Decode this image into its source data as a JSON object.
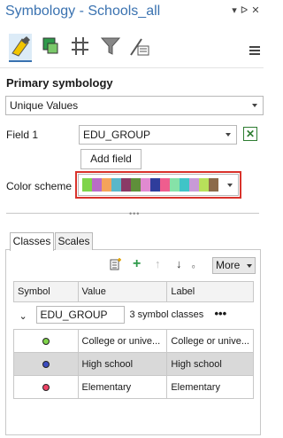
{
  "window": {
    "title": "Symbology - Schools_all"
  },
  "tools": [
    {
      "name": "primary-symbology-icon"
    },
    {
      "name": "vary-symbology-icon"
    },
    {
      "name": "symbol-layer-icon"
    },
    {
      "name": "filter-icon"
    },
    {
      "name": "advanced-options-icon"
    }
  ],
  "primary": {
    "section_title": "Primary symbology",
    "method": "Unique Values",
    "field1_label": "Field 1",
    "field1_value": "EDU_GROUP",
    "add_field_label": "Add field",
    "color_scheme_label": "Color scheme",
    "color_scheme_colors": [
      "#7fd44a",
      "#b96cc7",
      "#f5a35a",
      "#5ab7c9",
      "#8a3a66",
      "#5f8f3a",
      "#e08ad0",
      "#2f3d9c",
      "#ef5d8e",
      "#86e2a8",
      "#40c4c7",
      "#c89ad6",
      "#b8e05a",
      "#8c6a4a"
    ],
    "accent": "#d9322b"
  },
  "tabs": [
    {
      "label": "Classes"
    },
    {
      "label": "Scales"
    }
  ],
  "toolbar": {
    "more_label": "More"
  },
  "table": {
    "headers": [
      "Symbol",
      "Value",
      "Label"
    ],
    "group_field": "EDU_GROUP",
    "group_summary": "3 symbol classes",
    "rows": [
      {
        "value": "College or unive...",
        "label": "College or unive...",
        "color": "#7fd44a"
      },
      {
        "value": "High school",
        "label": "High school",
        "color": "#3b4cc0"
      },
      {
        "value": "Elementary",
        "label": "Elementary",
        "color": "#ee4466"
      }
    ]
  }
}
